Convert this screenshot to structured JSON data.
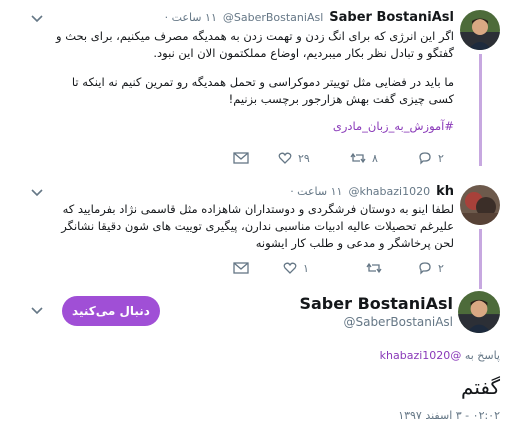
{
  "tweet1": {
    "name": "Saber BostaniAsl",
    "handle": "@SaberBostaniAsl",
    "time": "۱۱ ساعت ·",
    "line1": "اگر این انرژی که برای انگ زدن و تهمت زدن به همدیگه مصرف میکنیم، برای بحث و",
    "line2": "گفتگو و تبادل نظر بکار میبردیم، اوضاع مملکتمون الان این نبود.",
    "line3": "ما باید در فضایی مثل توییتر دموکراسی و تحمل همدیگه رو تمرین کنیم نه اینکه تا",
    "line4": "کسی چیزی گفت بهش هزارجور برچسب بزنیم!",
    "hashtag": "#آموزش_به_زبان_مادری",
    "replies": "۲",
    "retweets": "۸",
    "likes": "۲۹"
  },
  "tweet2": {
    "name": "kh",
    "handle": "@khabazi1020",
    "time": "۱۱ ساعت ·",
    "line1": "لطفا اینو به دوستان فرشگردی و دوستداران شاهزاده مثل قاسمی نژاد بفرمایید که",
    "line2": "علیرغم تحصیلات عالیه ادبیات مناسبی ندارن، پیگیری توییت های شون دقیقا نشانگر",
    "line3": "لحن پرخاشگر و مدعی و طلب کار ایشونه",
    "replies": "۲",
    "retweets": "",
    "likes": "۱"
  },
  "main": {
    "name": "Saber BostaniAsl",
    "handle": "@SaberBostaniAsl",
    "follow_label": "دنبال می‌کنید",
    "reply_prefix": "پاسخ به",
    "reply_mention": "@khabazi1020",
    "text": "گفتم",
    "date": "۰۲:۰۲ - ۳ اسفند ۱۳۹۷"
  },
  "icons": {
    "reply": "reply-icon",
    "retweet": "retweet-icon",
    "like": "heart-icon",
    "dm": "envelope-icon",
    "more": "chevron-down-icon"
  },
  "colors": {
    "accent": "#a04fd6",
    "thread": "#c7a8e0",
    "hashtag": "#8a3ab9",
    "muted": "#657786"
  }
}
